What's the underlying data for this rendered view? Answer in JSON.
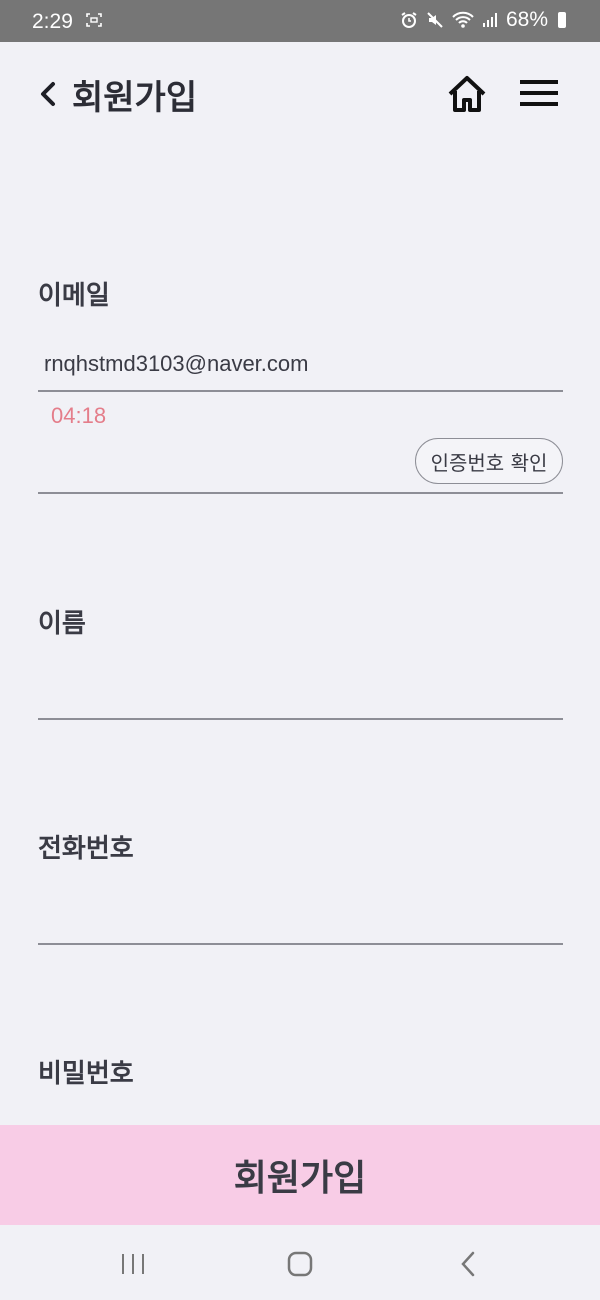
{
  "status_bar": {
    "time": "2:29",
    "battery": "68%"
  },
  "header": {
    "title": "회원가입"
  },
  "form": {
    "email_label": "이메일",
    "email_value": "rnqhstmd3103@naver.com",
    "timer": "04:18",
    "verify_button": "인증번호 확인",
    "name_label": "이름",
    "phone_label": "전화번호",
    "password_label": "비밀번호"
  },
  "submit_button": "회원가입",
  "colors": {
    "timer": "#e47d8a",
    "submit_bg": "#f8cce6",
    "statusbar_bg": "#767676",
    "page_bg": "#f1f1f6"
  }
}
